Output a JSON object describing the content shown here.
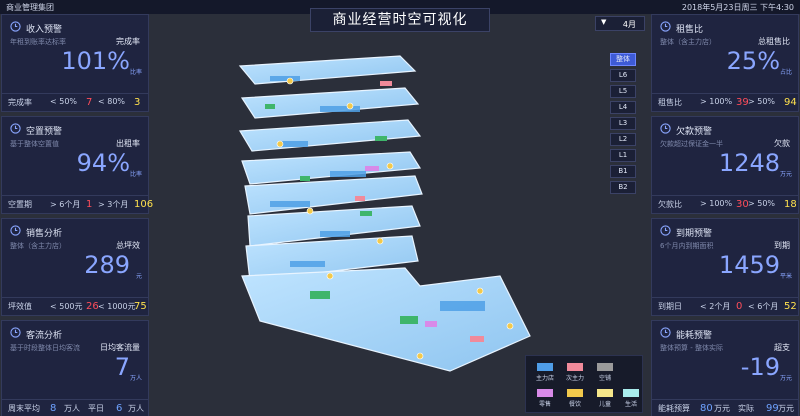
{
  "header": {
    "company": "商业管理集团",
    "title": "商业经营时空可视化",
    "datetime": "2018年5月23日周三 下午4:30",
    "month": "4月"
  },
  "left_panels": [
    {
      "title": "收入预警",
      "sub": "年租到账率达标率",
      "metric": "完成率",
      "value": "101%",
      "unit": "比率",
      "foot": [
        {
          "label": "完成率",
          "cond": "< 50%",
          "n": "7"
        },
        {
          "label": "",
          "cond": "< 80%",
          "n": "3"
        }
      ]
    },
    {
      "title": "空置预警",
      "sub": "基于整体空置值",
      "metric": "出租率",
      "value": "94%",
      "unit": "比率",
      "foot": [
        {
          "label": "空置期",
          "cond": "> 6个月",
          "n": "1"
        },
        {
          "label": "",
          "cond": "> 3个月",
          "n": "106"
        }
      ]
    },
    {
      "title": "销售分析",
      "sub": "整体（含主力店）",
      "metric": "总坪效",
      "value": "289",
      "unit": "元",
      "foot": [
        {
          "label": "坪效值",
          "cond": "< 500元",
          "n": "26"
        },
        {
          "label": "",
          "cond": "< 1000元",
          "n": "75"
        }
      ]
    },
    {
      "title": "客流分析",
      "sub": "基于时段整体日均客流",
      "metric": "日均客流量",
      "value": "7",
      "unit": "万人",
      "foot": [
        {
          "label": "周末平均",
          "cond": "",
          "n": "8",
          "suf": "万人"
        },
        {
          "label": "平日",
          "cond": "",
          "n": "6",
          "suf": "万人"
        }
      ]
    }
  ],
  "right_panels": [
    {
      "title": "租售比",
      "sub": "整体（含主力店）",
      "metric": "总租售比",
      "value": "25%",
      "unit": "占比",
      "foot": [
        {
          "label": "租售比",
          "cond": "> 100%",
          "n": "39"
        },
        {
          "label": "",
          "cond": "> 50%",
          "n": "94"
        }
      ]
    },
    {
      "title": "欠款预警",
      "sub": "欠款超过保证金一半",
      "metric": "欠款",
      "value": "1248",
      "unit": "万元",
      "foot": [
        {
          "label": "欠款比",
          "cond": "> 100%",
          "n": "30"
        },
        {
          "label": "",
          "cond": "> 50%",
          "n": "18"
        }
      ]
    },
    {
      "title": "到期预警",
      "sub": "6个月内到期面积",
      "metric": "到期",
      "value": "1459",
      "unit": "平米",
      "foot": [
        {
          "label": "到期日",
          "cond": "< 2个月",
          "n": "0"
        },
        {
          "label": "",
          "cond": "< 6个月",
          "n": "52"
        }
      ]
    },
    {
      "title": "能耗预警",
      "sub": "整体预算 - 整体实际",
      "metric": "超支",
      "value": "-19",
      "unit": "万元",
      "foot": [
        {
          "label": "能耗预算",
          "cond": "",
          "n": "80",
          "suf": "万元"
        },
        {
          "label": "实际",
          "cond": "",
          "n": "99",
          "suf": "万元"
        }
      ]
    }
  ],
  "floors": [
    "整体",
    "L6",
    "L5",
    "L4",
    "L3",
    "L2",
    "L1",
    "B1",
    "B2"
  ],
  "active_floor": "整体",
  "legend": [
    {
      "label": "主力店",
      "color": "#4f9de8"
    },
    {
      "label": "次主力",
      "color": "#f08a9a"
    },
    {
      "label": "空铺",
      "color": "#9a9a9a"
    },
    {
      "label": "零售",
      "color": "#d88ae8"
    },
    {
      "label": "餐饮",
      "color": "#f2c94c"
    },
    {
      "label": "儿童",
      "color": "#f5e68a"
    },
    {
      "label": "生活",
      "color": "#a8ecec"
    }
  ]
}
